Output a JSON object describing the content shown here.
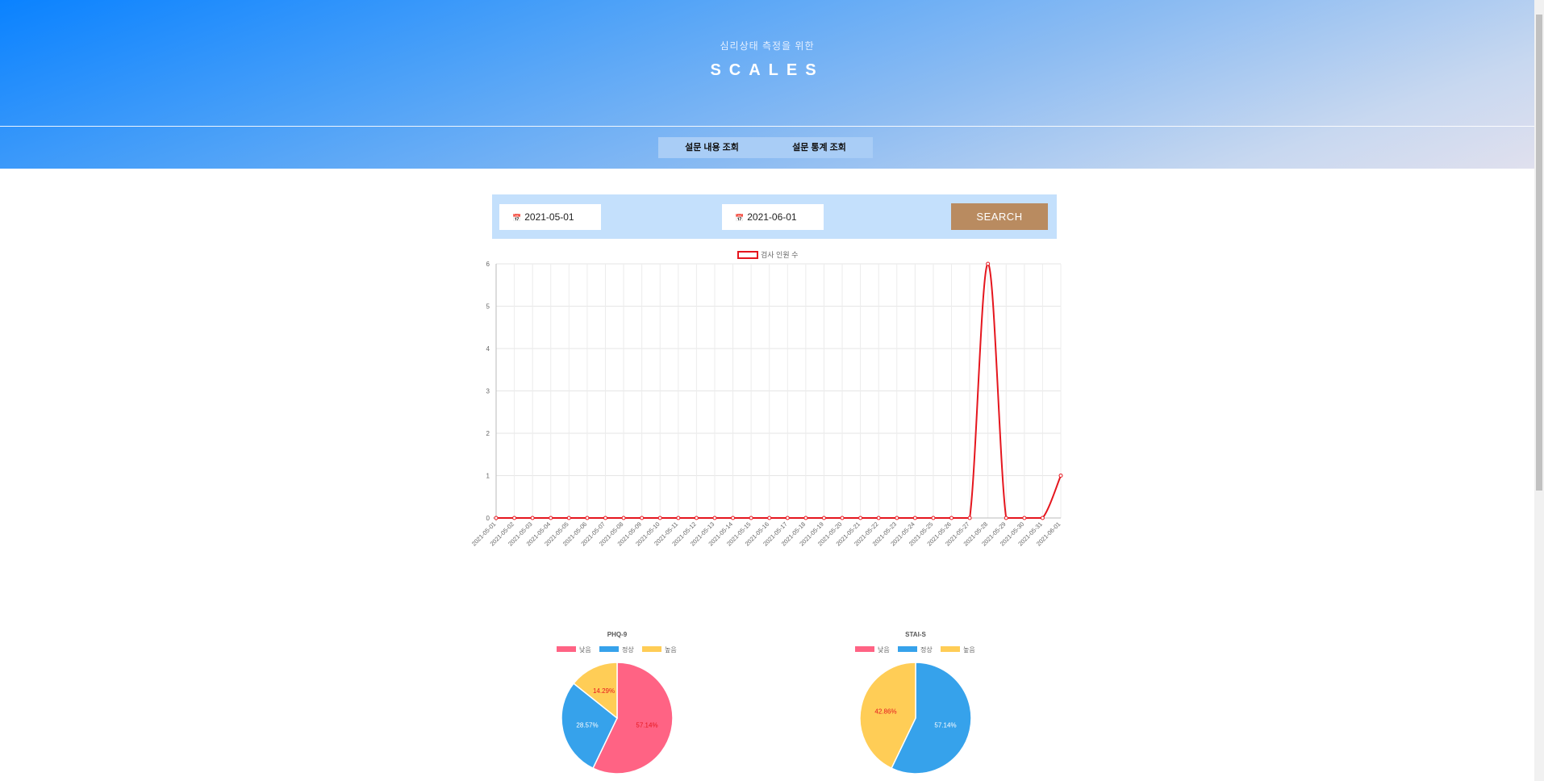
{
  "header": {
    "subtitle": "심리상태 측정을 위한",
    "title": "SCALES"
  },
  "nav": {
    "items": [
      {
        "label": "설문 내용 조회"
      },
      {
        "label": "설문 통계 조회"
      }
    ]
  },
  "search": {
    "start_date": "2021-05-01",
    "end_date": "2021-06-01",
    "button_label": "SEARCH"
  },
  "colors": {
    "line": "#e5161e",
    "low": "#ff6384",
    "normal": "#36a2eb",
    "high": "#ffcd56",
    "button": "#b98b60"
  },
  "chart_data": [
    {
      "type": "line",
      "title": "",
      "legend": "검사 인원 수",
      "legend_position": "top",
      "categories": [
        "2021-05-01",
        "2021-05-02",
        "2021-05-03",
        "2021-05-04",
        "2021-05-05",
        "2021-05-06",
        "2021-05-07",
        "2021-05-08",
        "2021-05-09",
        "2021-05-10",
        "2021-05-11",
        "2021-05-12",
        "2021-05-13",
        "2021-05-14",
        "2021-05-15",
        "2021-05-16",
        "2021-05-17",
        "2021-05-18",
        "2021-05-19",
        "2021-05-20",
        "2021-05-21",
        "2021-05-22",
        "2021-05-23",
        "2021-05-24",
        "2021-05-25",
        "2021-05-26",
        "2021-05-27",
        "2021-05-28",
        "2021-05-29",
        "2021-05-30",
        "2021-05-31",
        "2021-06-01"
      ],
      "series": [
        {
          "name": "검사 인원 수",
          "values": [
            0,
            0,
            0,
            0,
            0,
            0,
            0,
            0,
            0,
            0,
            0,
            0,
            0,
            0,
            0,
            0,
            0,
            0,
            0,
            0,
            0,
            0,
            0,
            0,
            0,
            0,
            0,
            6,
            0,
            0,
            0,
            1
          ]
        }
      ],
      "yticks": [
        0,
        1,
        2,
        3,
        4,
        5,
        6
      ],
      "ylim": [
        0,
        6
      ],
      "grid": true
    },
    {
      "type": "pie",
      "title": "PHQ-9",
      "legend_position": "top",
      "labels": [
        "낮음",
        "정상",
        "높음"
      ],
      "values": [
        57.14,
        28.57,
        14.29
      ],
      "value_labels": [
        "57.14%",
        "28.57%",
        "14.29%"
      ]
    },
    {
      "type": "pie",
      "title": "STAI-S",
      "legend_position": "top",
      "labels": [
        "낮음",
        "정상",
        "높음"
      ],
      "values": [
        0,
        57.14,
        42.86
      ],
      "value_labels": [
        "",
        "57.14%",
        "42.86%"
      ]
    }
  ]
}
